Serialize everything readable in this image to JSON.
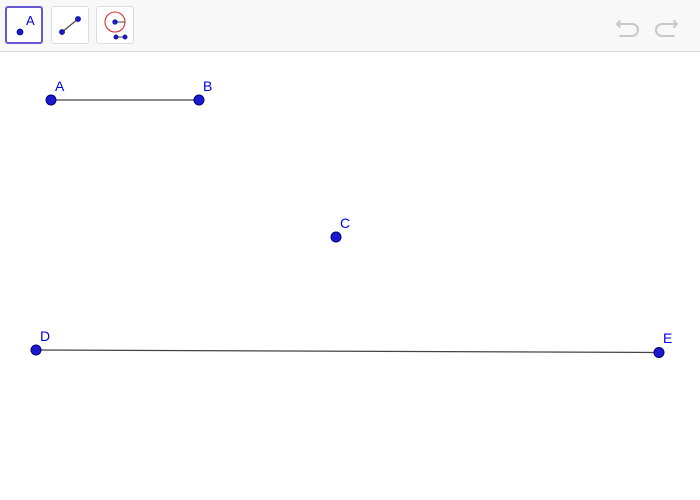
{
  "toolbar": {
    "tools": [
      {
        "name": "point-tool",
        "icon": "point-icon",
        "glyph_label": "A",
        "selected": true
      },
      {
        "name": "segment-tool",
        "icon": "segment-icon",
        "selected": false
      },
      {
        "name": "compass-tool",
        "icon": "compass-icon",
        "selected": false
      }
    ],
    "undo_icon": "undo-icon",
    "redo_icon": "redo-icon"
  },
  "colors": {
    "point_fill": "#1a1acc",
    "point_stroke": "#00007a",
    "label": "#0000e6",
    "segment": "#444444",
    "tool_selected_border": "#6557d2",
    "compass_circle": "#e03030",
    "history_icon": "#c8c8c8"
  },
  "points": {
    "A": {
      "label": "A"
    },
    "B": {
      "label": "B"
    },
    "C": {
      "label": "C"
    },
    "D": {
      "label": "D"
    },
    "E": {
      "label": "E"
    }
  },
  "segments": [
    {
      "from": "A",
      "to": "B"
    },
    {
      "from": "D",
      "to": "E"
    }
  ]
}
